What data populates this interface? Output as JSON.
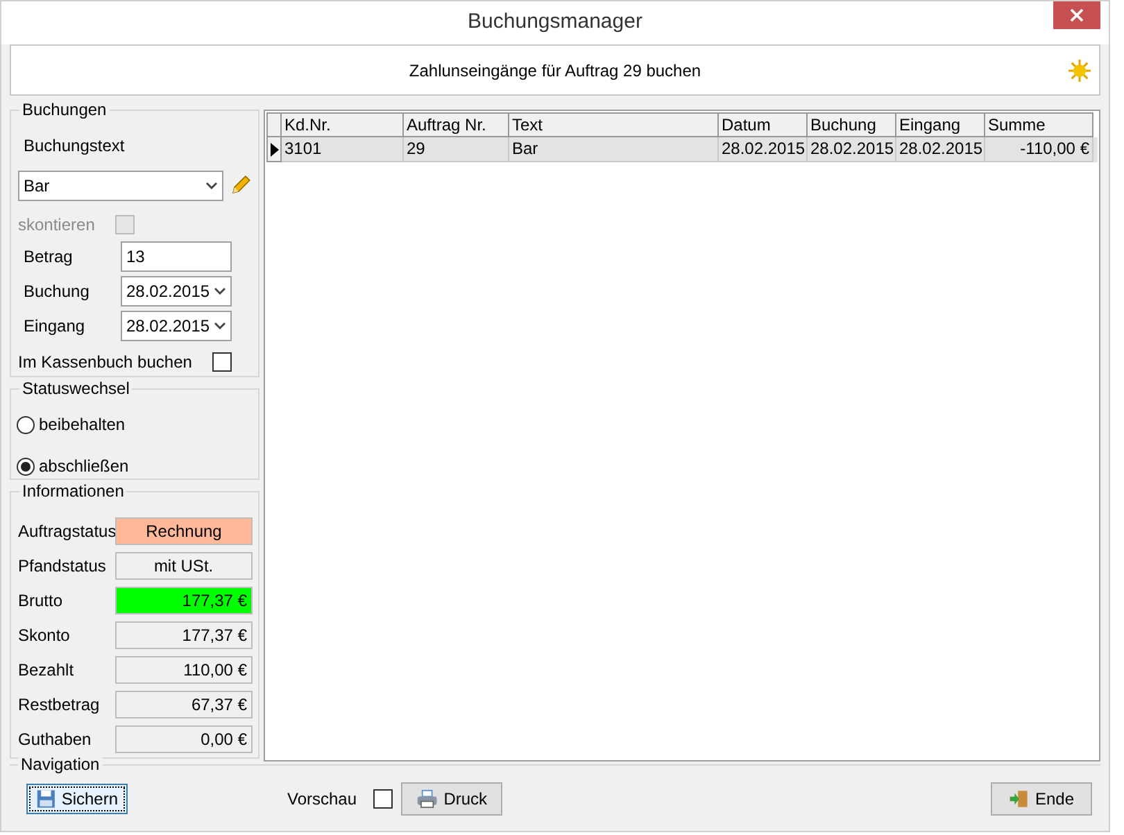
{
  "window": {
    "title": "Buchungsmanager"
  },
  "header": {
    "text": "Zahlunseingänge für Auftrag 29 buchen"
  },
  "buchungen": {
    "title": "Buchungen",
    "buchungstext_label": "Buchungstext",
    "buchungstext_value": "Bar",
    "skontieren": {
      "label": "skontieren",
      "checked": false,
      "disabled": true
    },
    "betrag": {
      "label": "Betrag",
      "value": "13"
    },
    "buchung": {
      "label": "Buchung",
      "value": "28.02.2015"
    },
    "eingang": {
      "label": "Eingang",
      "value": "28.02.2015"
    },
    "kassenbuch": {
      "label": "Im Kassenbuch buchen",
      "checked": false
    }
  },
  "statuswechsel": {
    "title": "Statuswechsel",
    "options": [
      {
        "label": "beibehalten",
        "selected": false
      },
      {
        "label": "abschließen",
        "selected": true
      }
    ]
  },
  "informationen": {
    "title": "Informationen",
    "items": [
      {
        "label": "Auftragstatus",
        "value": "Rechnung",
        "kind": "status",
        "color": "#ffb898"
      },
      {
        "label": "Pfandstatus",
        "value": "mit USt.",
        "kind": "status",
        "color": "#f0f0f0"
      },
      {
        "label": "Brutto",
        "value": "177,37 €",
        "kind": "amount",
        "color": "#00ff00"
      },
      {
        "label": "Skonto",
        "value": "177,37 €",
        "kind": "amount",
        "color": "#f0f0f0"
      },
      {
        "label": "Bezahlt",
        "value": "110,00 €",
        "kind": "amount",
        "color": "#f0f0f0"
      },
      {
        "label": "Restbetrag",
        "value": "67,37 €",
        "kind": "amount",
        "color": "#f0f0f0"
      },
      {
        "label": "Guthaben",
        "value": "0,00 €",
        "kind": "amount",
        "color": "#f0f0f0"
      }
    ]
  },
  "table": {
    "columns": [
      "Kd.Nr.",
      "Auftrag Nr.",
      "Text",
      "Datum",
      "Buchung",
      "Eingang",
      "Summe"
    ],
    "rows": [
      {
        "selected": true,
        "cells": [
          "3101",
          "29",
          "Bar",
          "28.02.2015",
          "28.02.2015",
          "28.02.2015",
          "-110,00 €"
        ]
      }
    ]
  },
  "navigation": {
    "title": "Navigation",
    "save": "Sichern",
    "preview": {
      "label": "Vorschau",
      "checked": false
    },
    "print": "Druck",
    "end": "Ende"
  }
}
